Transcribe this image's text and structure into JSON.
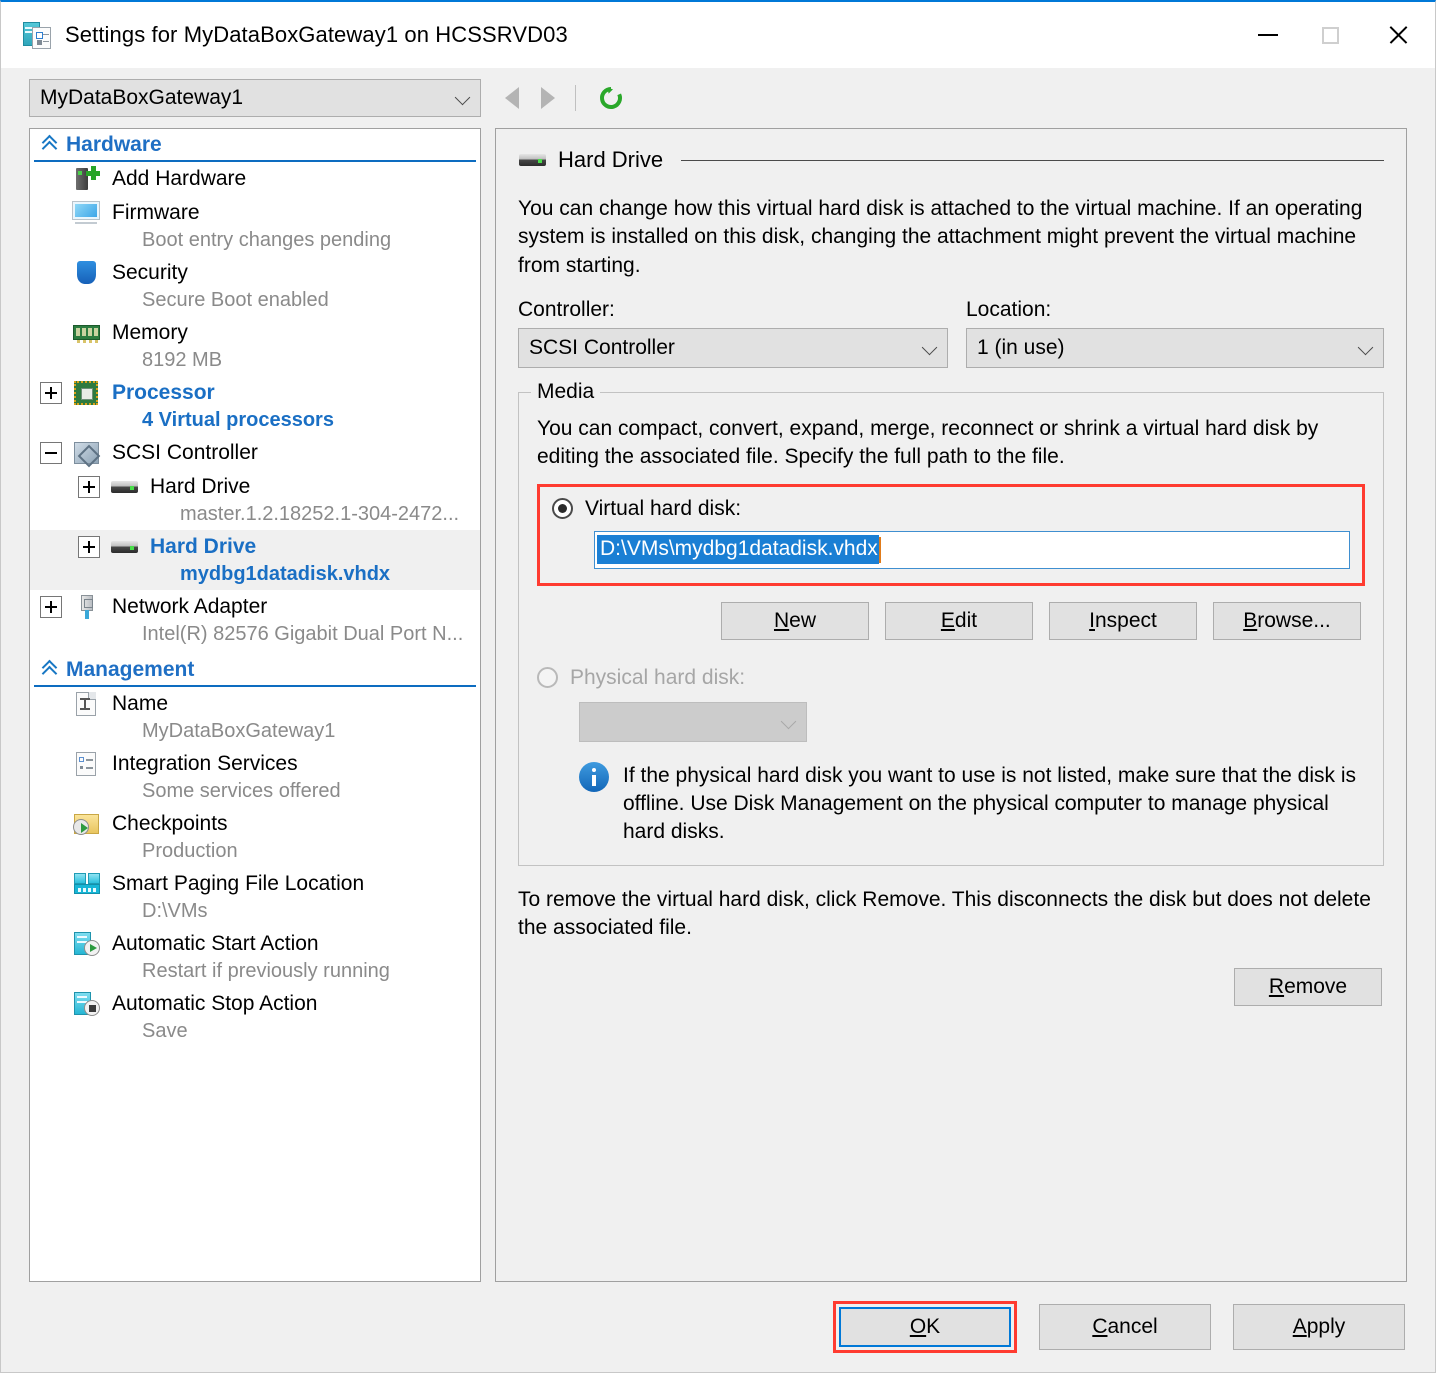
{
  "window": {
    "title": "Settings for MyDataBoxGateway1 on HCSSRVD03",
    "icon": "vm-settings-icon",
    "minimize": "minimize-icon",
    "maximize": "maximize-icon",
    "close": "close-icon"
  },
  "toolbar": {
    "vm_selected": "MyDataBoxGateway1",
    "back": "back-arrow-icon",
    "forward": "forward-arrow-icon",
    "refresh": "refresh-icon"
  },
  "tree": {
    "groups": [
      {
        "label": "Hardware",
        "items": [
          {
            "label": "Add Hardware",
            "sub": "",
            "icon": "add-hardware-icon",
            "expander": "none",
            "selected": false,
            "highlight": false
          },
          {
            "label": "Firmware",
            "sub": "Boot entry changes pending",
            "icon": "firmware-icon",
            "expander": "none",
            "selected": false,
            "highlight": false
          },
          {
            "label": "Security",
            "sub": "Secure Boot enabled",
            "icon": "security-shield-icon",
            "expander": "none",
            "selected": false,
            "highlight": false
          },
          {
            "label": "Memory",
            "sub": "8192 MB",
            "icon": "memory-icon",
            "expander": "none",
            "selected": false,
            "highlight": false
          },
          {
            "label": "Processor",
            "sub": "4 Virtual processors",
            "icon": "processor-icon",
            "expander": "plus",
            "selected": false,
            "highlight": true
          },
          {
            "label": "SCSI Controller",
            "sub": "",
            "icon": "scsi-controller-icon",
            "expander": "minus",
            "selected": false,
            "highlight": false
          },
          {
            "label": "Hard Drive",
            "sub": "master.1.2.18252.1-304-2472...",
            "icon": "hard-drive-icon",
            "expander": "plus",
            "selected": false,
            "highlight": false,
            "indent": 1
          },
          {
            "label": "Hard Drive",
            "sub": "mydbg1datadisk.vhdx",
            "icon": "hard-drive-icon",
            "expander": "plus",
            "selected": true,
            "highlight": true,
            "indent": 1
          },
          {
            "label": "Network Adapter",
            "sub": "Intel(R) 82576 Gigabit Dual Port N...",
            "icon": "network-adapter-icon",
            "expander": "plus",
            "selected": false,
            "highlight": false
          }
        ]
      },
      {
        "label": "Management",
        "items": [
          {
            "label": "Name",
            "sub": "MyDataBoxGateway1",
            "icon": "name-document-icon",
            "expander": "none",
            "selected": false,
            "highlight": false
          },
          {
            "label": "Integration Services",
            "sub": "Some services offered",
            "icon": "integration-services-icon",
            "expander": "none",
            "selected": false,
            "highlight": false
          },
          {
            "label": "Checkpoints",
            "sub": "Production",
            "icon": "checkpoints-icon",
            "expander": "none",
            "selected": false,
            "highlight": false
          },
          {
            "label": "Smart Paging File Location",
            "sub": "D:\\VMs",
            "icon": "smart-paging-icon",
            "expander": "none",
            "selected": false,
            "highlight": false
          },
          {
            "label": "Automatic Start Action",
            "sub": "Restart if previously running",
            "icon": "automatic-start-icon",
            "expander": "none",
            "selected": false,
            "highlight": false
          },
          {
            "label": "Automatic Stop Action",
            "sub": "Save",
            "icon": "automatic-stop-icon",
            "expander": "none",
            "selected": false,
            "highlight": false
          }
        ]
      }
    ]
  },
  "detail": {
    "section_title": "Hard Drive",
    "section_icon": "hard-drive-icon",
    "description": "You can change how this virtual hard disk is attached to the virtual machine. If an operating system is installed on this disk, changing the attachment might prevent the virtual machine from starting.",
    "controller_label": "Controller:",
    "controller_value": "SCSI Controller",
    "location_label": "Location:",
    "location_value": "1 (in use)",
    "media": {
      "title": "Media",
      "help": "You can compact, convert, expand, merge, reconnect or shrink a virtual hard disk by editing the associated file. Specify the full path to the file.",
      "virtual_disk_label": "Virtual hard disk:",
      "virtual_disk_path": "D:\\VMs\\mydbg1datadisk.vhdx",
      "buttons": [
        "New",
        "Edit",
        "Inspect",
        "Browse..."
      ],
      "physical_disk_label": "Physical hard disk:",
      "physical_disk_value": "",
      "info_icon": "info-icon",
      "info_text": "If the physical hard disk you want to use is not listed, make sure that the disk is offline. Use Disk Management on the physical computer to manage physical hard disks."
    },
    "remove_help": "To remove the virtual hard disk, click Remove. This disconnects the disk but does not delete the associated file.",
    "remove_label": "Remove"
  },
  "footer": {
    "ok": "OK",
    "cancel": "Cancel",
    "apply": "Apply"
  },
  "colors": {
    "accent": "#0078d7",
    "link_blue": "#1a6fc4",
    "highlight_red": "#ff3b30",
    "selection_blue": "#1a7fd4"
  }
}
